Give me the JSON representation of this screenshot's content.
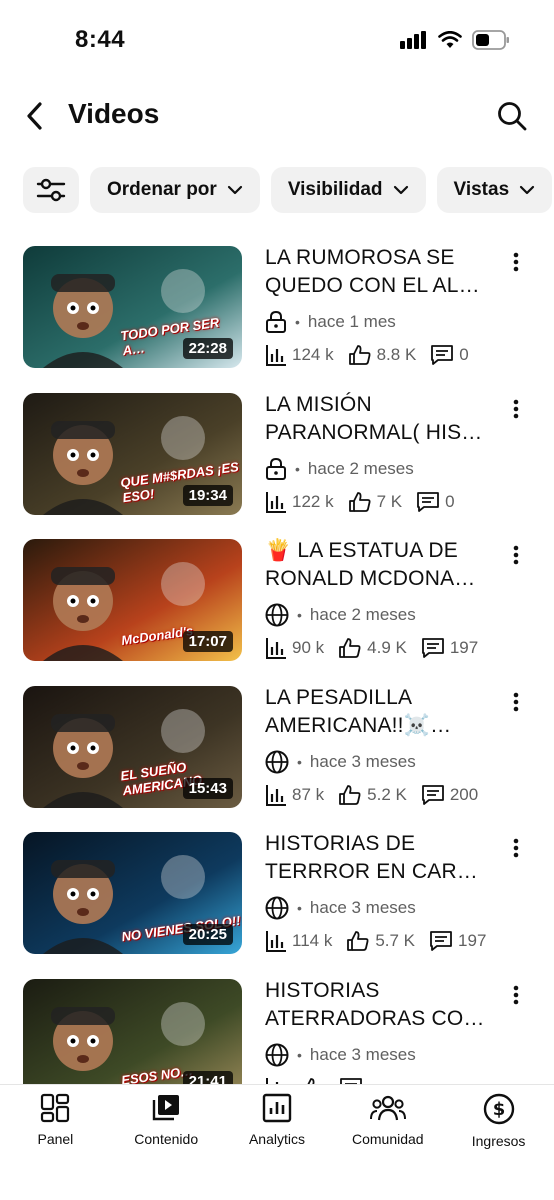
{
  "status_bar": {
    "time": "8:44"
  },
  "header": {
    "title": "Videos",
    "back_icon": "chevron-left-icon",
    "search_icon": "search-icon"
  },
  "filters": [
    {
      "label": "Ordenar por"
    },
    {
      "label": "Visibilidad"
    },
    {
      "label": "Vistas"
    }
  ],
  "videos": [
    {
      "title_line1": "LA RUMOROSA SE",
      "title_line2": "QUEDO CON EL AL…",
      "visibility": "lock",
      "age": "hace 1 mes",
      "views": "124 k",
      "likes": "8.8 K",
      "comments": "0",
      "duration": "22:28",
      "thumb_text": "TODO POR SER A…",
      "colors": [
        "#0f3b3a",
        "#2c6e6a",
        "#d7e8ee"
      ]
    },
    {
      "title_line1": "LA MISIÓN",
      "title_line2": "PARANORMAL( HIS…",
      "visibility": "lock",
      "age": "hace 2 meses",
      "views": "122 k",
      "likes": "7 K",
      "comments": "0",
      "duration": "19:34",
      "thumb_text": "QUE M#$RDAS ¡ES ESO!",
      "colors": [
        "#1e1a14",
        "#4a4028",
        "#8a7a52"
      ]
    },
    {
      "title_line1": "🍟 LA ESTATUA DE",
      "title_line2": "RONALD MCDONA…",
      "visibility": "globe",
      "age": "hace 2 meses",
      "views": "90 k",
      "likes": "4.9 K",
      "comments": "197",
      "duration": "17:07",
      "thumb_text": "McDonald's",
      "colors": [
        "#2a1a0c",
        "#b8421c",
        "#f2c14a"
      ]
    },
    {
      "title_line1": "LA PESADILLA",
      "title_line2": "AMERICANA!!☠️…",
      "visibility": "globe",
      "age": "hace 3 meses",
      "views": "87 k",
      "likes": "5.2 K",
      "comments": "200",
      "duration": "15:43",
      "thumb_text": "EL SUEÑO AMERICANO",
      "colors": [
        "#1a1410",
        "#3d3424",
        "#6b5c42"
      ]
    },
    {
      "title_line1": "HISTORIAS DE",
      "title_line2": "TERRROR  EN CAR…",
      "visibility": "globe",
      "age": "hace 3 meses",
      "views": "114 k",
      "likes": "5.7 K",
      "comments": "197",
      "duration": "20:25",
      "thumb_text": "NO VIENES SOLO!!",
      "colors": [
        "#061524",
        "#0e3a5e",
        "#37a6d8"
      ]
    },
    {
      "title_line1": "HISTORIAS",
      "title_line2": "ATERRADORAS CO…",
      "visibility": "globe",
      "age": "hace 3 meses",
      "views": "",
      "likes": "",
      "comments": "",
      "duration": "21:41",
      "thumb_text": "ESOS NO…",
      "colors": [
        "#1b1c12",
        "#3e4a26",
        "#9c8b5a"
      ]
    }
  ],
  "bottom_nav": [
    {
      "label": "Panel",
      "icon": "dashboard-icon"
    },
    {
      "label": "Contenido",
      "icon": "content-icon"
    },
    {
      "label": "Analytics",
      "icon": "analytics-icon"
    },
    {
      "label": "Comunidad",
      "icon": "community-icon"
    },
    {
      "label": "Ingresos",
      "icon": "earnings-icon"
    }
  ]
}
